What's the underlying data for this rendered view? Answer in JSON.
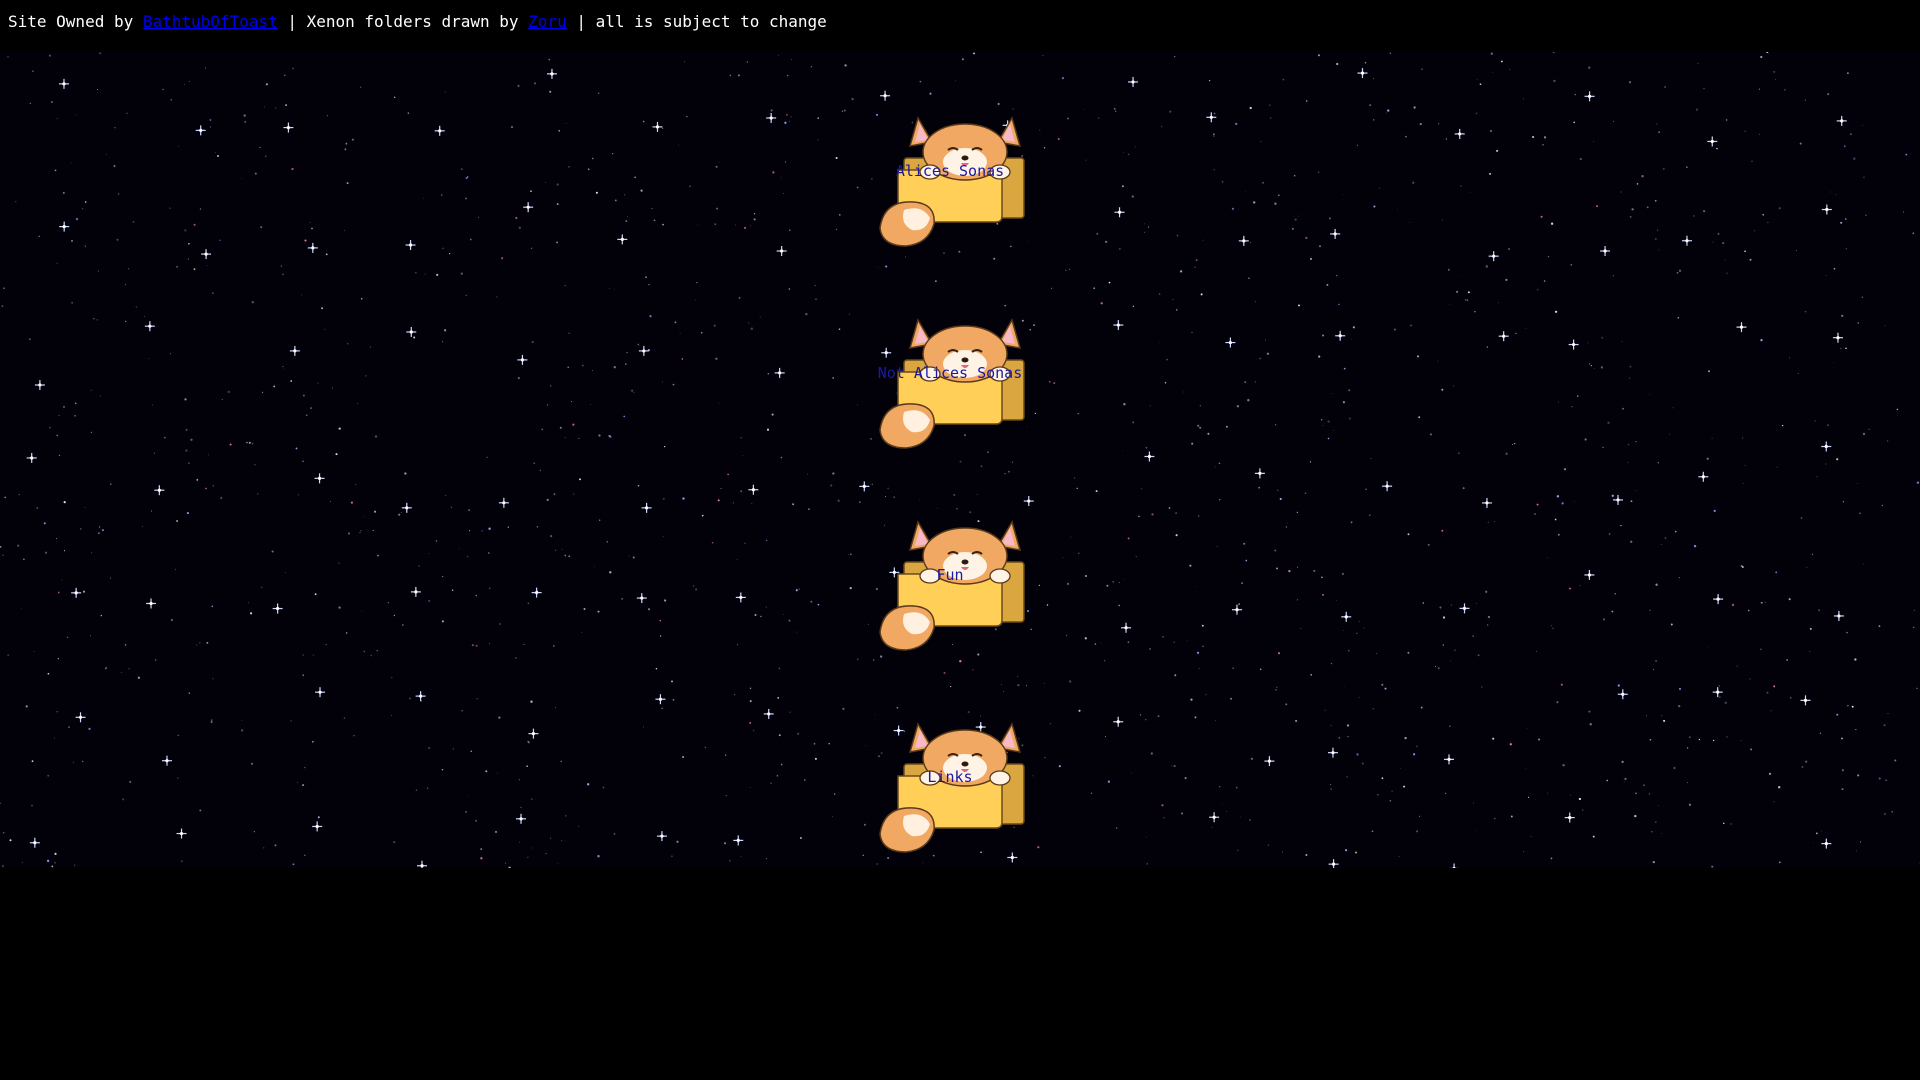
{
  "header": {
    "prefix": "Site Owned by ",
    "owner_link": "BathtubOfToast",
    "middle": " | Xenon folders drawn by ",
    "artist_link": "Zoru",
    "suffix": " | all is subject to change"
  },
  "folders": [
    {
      "label": "Alices Sonas"
    },
    {
      "label": "Not Alices Sonas"
    },
    {
      "label": "Fun"
    },
    {
      "label": "Links"
    }
  ],
  "colors": {
    "background": "#000000",
    "link": "#0000ee",
    "folder_fill": "#ffcf57",
    "fox_fur": "#f0a862",
    "folder_label": "#1a1aa0"
  },
  "icons": [
    "fox-folder-icon"
  ]
}
